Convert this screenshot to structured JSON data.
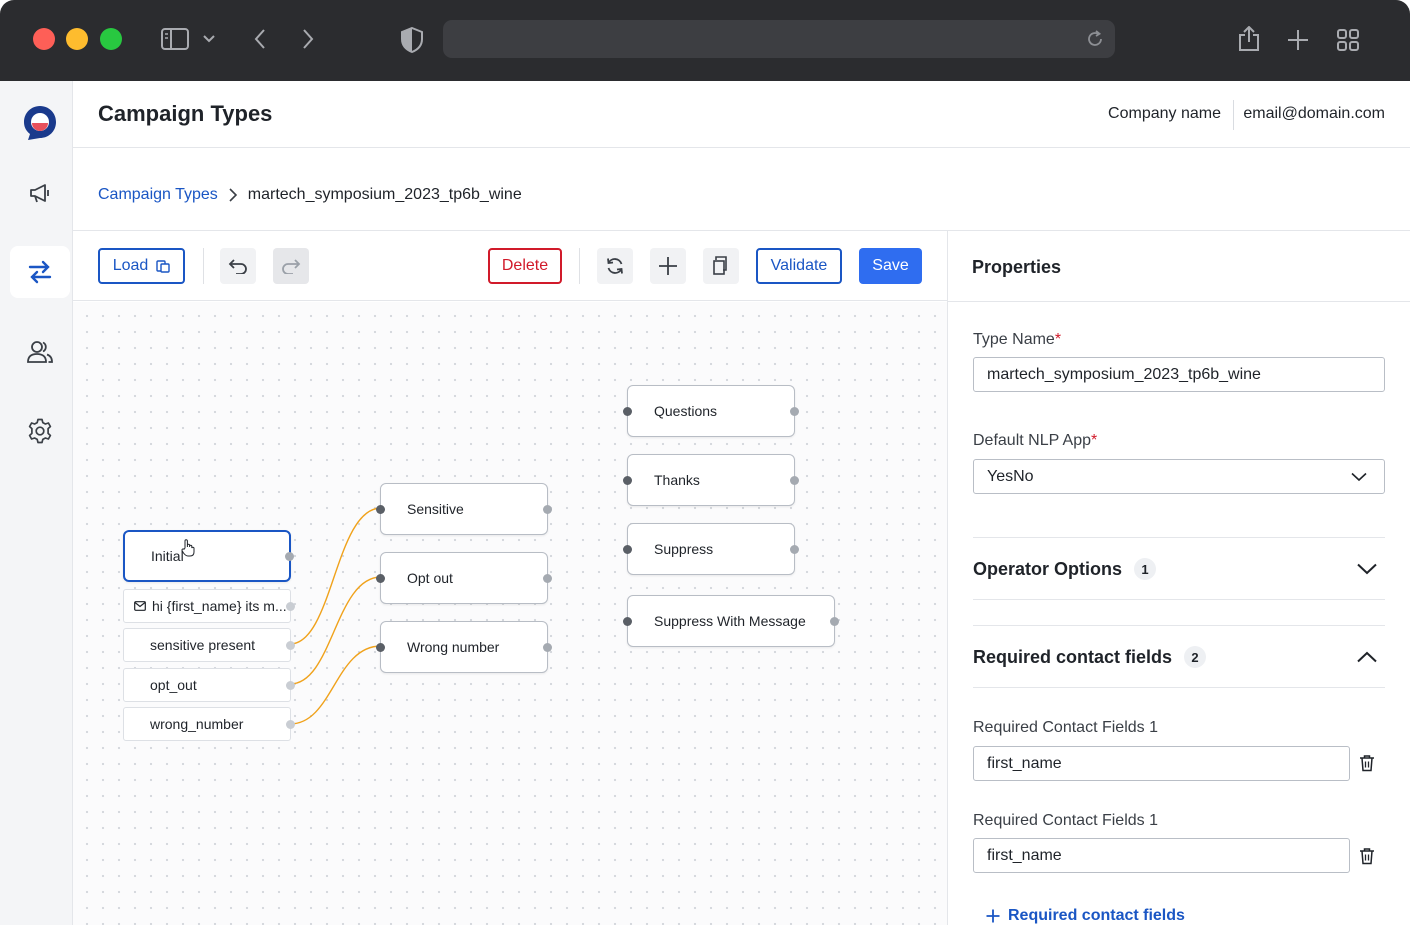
{
  "app": {
    "title": "Campaign Types",
    "company": "Company name",
    "email": "email@domain.com"
  },
  "breadcrumb": {
    "parent": "Campaign Types",
    "current": "martech_symposium_2023_tp6b_wine"
  },
  "toolbar": {
    "load_label": "Load",
    "delete_label": "Delete",
    "validate_label": "Validate",
    "save_label": "Save"
  },
  "flow": {
    "initial": "Initial",
    "message": "hi {first_name} its m...",
    "sub_outputs": [
      "sensitive present",
      "opt_out",
      "wrong_number"
    ],
    "middle_nodes": [
      "Sensitive",
      "Opt out",
      "Wrong number"
    ],
    "right_nodes": [
      "Questions",
      "Thanks",
      "Suppress",
      "Suppress With Message"
    ]
  },
  "properties": {
    "title": "Properties",
    "type_name_label": "Type Name",
    "type_name_value": "martech_symposium_2023_tp6b_wine",
    "nlp_label": "Default NLP App",
    "nlp_value": "YesNo",
    "operator_options": {
      "label": "Operator Options",
      "count": "1"
    },
    "required_fields": {
      "label": "Required contact fields",
      "count": "2",
      "fields": [
        {
          "label": "Required Contact Fields 1",
          "value": "first_name"
        },
        {
          "label": "Required Contact Fields 1",
          "value": "first_name"
        }
      ],
      "add_label": "Required contact fields"
    }
  },
  "colors": {
    "accent": "#1a56c4",
    "primary_button": "#2f6df0",
    "danger": "#d11a2a",
    "edge": "#f0a21b"
  }
}
